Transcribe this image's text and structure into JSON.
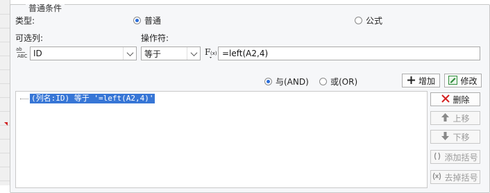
{
  "group_title": "普通条件",
  "type_label": "类型:",
  "type_options": {
    "normal": "普通",
    "formula": "公式"
  },
  "column_label": "可选列:",
  "operator_label": "操作符:",
  "column_value": "ID",
  "operator_value": "等于",
  "value_text": "=left(A2,4)",
  "logic_options": {
    "and": "与(AND)",
    "or": "或(OR)"
  },
  "buttons": {
    "add": "增加",
    "modify": "修改",
    "delete": "删除",
    "move_up": "上移",
    "move_down": "下移",
    "add_bracket": "添加括号",
    "remove_bracket": "去掉括号"
  },
  "tree_items": [
    "(列名:ID) 等于 '=left(A2,4)'"
  ],
  "icons": {
    "column": "abc-field-icon",
    "formula": "fx-icon",
    "add": "plus-icon",
    "modify": "edit-icon",
    "delete": "red-x-icon",
    "move_up": "up-arrow-icon",
    "move_down": "down-arrow-icon"
  },
  "colors": {
    "selection": "#3776d6",
    "delete": "#d42020",
    "modify": "#2e8b3a",
    "radio_on": "#2a6dd9"
  }
}
